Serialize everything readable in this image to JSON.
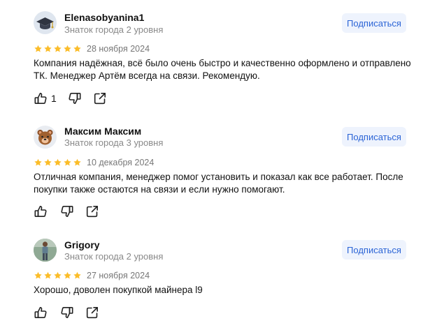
{
  "reviews": [
    {
      "author": "Elenasobyanina1",
      "level": "Знаток города 2 уровня",
      "subscribe": "Подписаться",
      "rating": 5,
      "date": "28 ноября 2024",
      "text": "Компания надёжная, всё было очень быстро и качественно оформлено и отправлено ТК. Менеджер Артём всегда на связи. Рекомендую.",
      "likes": "1",
      "avatar_icon": "graduation-cap-icon"
    },
    {
      "author": "Максим Максим",
      "level": "Знаток города 3 уровня",
      "subscribe": "Подписаться",
      "rating": 5,
      "date": "10 декабря 2024",
      "text": "Отличная компания, менеджер помог установить и показал как все работает. После покупки также остаются на связи и если нужно помогают.",
      "likes": "",
      "avatar_icon": "bear-icon"
    },
    {
      "author": "Grigory",
      "level": "Знаток города 2 уровня",
      "subscribe": "Подписаться",
      "rating": 5,
      "date": "27 ноября 2024",
      "text": "Хорошо, доволен покупкой майнера l9",
      "likes": "",
      "avatar_icon": "person-photo-icon"
    }
  ],
  "colors": {
    "star": "#fbbd2a",
    "subscribe_bg": "#eef3fd",
    "subscribe_text": "#2b64d6",
    "muted": "#898989"
  }
}
